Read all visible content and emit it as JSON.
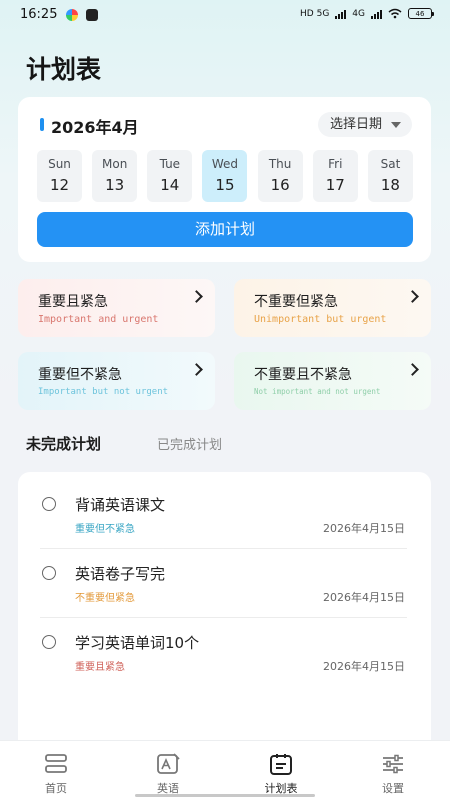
{
  "status_bar": {
    "time": "16:25",
    "network_1": "HD 5G",
    "network_2": "4G",
    "battery": "46"
  },
  "page_title": "计划表",
  "calendar": {
    "month_label": "2026年4月",
    "date_picker_label": "选择日期",
    "days": [
      {
        "name": "Sun",
        "date": "12"
      },
      {
        "name": "Mon",
        "date": "13"
      },
      {
        "name": "Tue",
        "date": "14"
      },
      {
        "name": "Wed",
        "date": "15"
      },
      {
        "name": "Thu",
        "date": "16"
      },
      {
        "name": "Fri",
        "date": "17"
      },
      {
        "name": "Sat",
        "date": "18"
      }
    ],
    "selected_day": "Wed",
    "add_button_label": "添加计划"
  },
  "quadrants": [
    {
      "title": "重要且紧急",
      "subtitle": "Important and urgent",
      "color": "#d9776f"
    },
    {
      "title": "不重要但紧急",
      "subtitle": "Unimportant but urgent",
      "color": "#e8a349"
    },
    {
      "title": "重要但不紧急",
      "subtitle": "Important but not urgent",
      "color": "#6ec4dc"
    },
    {
      "title": "不重要且不紧急",
      "subtitle": "Not important and not urgent",
      "color": "#8fcfa9"
    }
  ],
  "tabs": {
    "active": "未完成计划",
    "inactive": "已完成计划"
  },
  "tasks": [
    {
      "title": "背诵英语课文",
      "tag": "重要但不紧急",
      "tag_color": "#3aa6c4",
      "date": "2026年4月15日"
    },
    {
      "title": "英语卷子写完",
      "tag": "不重要但紧急",
      "tag_color": "#e39a3b",
      "date": "2026年4月15日"
    },
    {
      "title": "学习英语单词10个",
      "tag": "重要且紧急",
      "tag_color": "#d0635b",
      "date": "2026年4月15日"
    }
  ],
  "bottom_nav": [
    {
      "label": "首页",
      "icon": "home-icon"
    },
    {
      "label": "英语",
      "icon": "english-icon"
    },
    {
      "label": "计划表",
      "icon": "plan-icon",
      "active": true
    },
    {
      "label": "设置",
      "icon": "settings-icon"
    }
  ],
  "colors": {
    "accent": "#2492f4",
    "selected_day_bg": "#cdeefb"
  }
}
